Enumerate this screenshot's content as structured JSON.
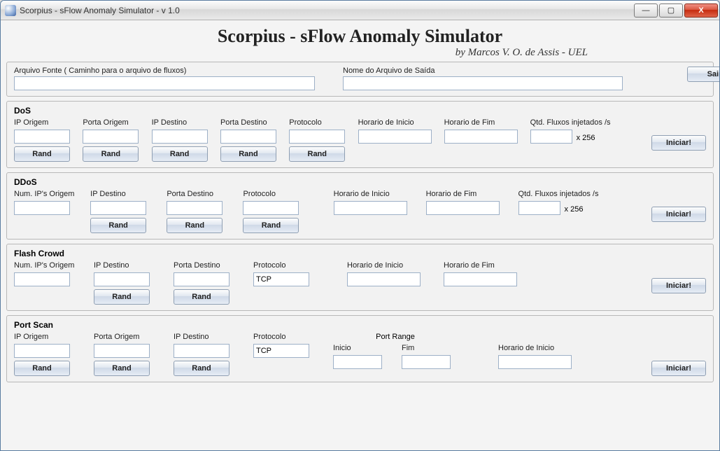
{
  "window": {
    "title": "Scorpius - sFlow Anomaly Simulator - v 1.0"
  },
  "header": {
    "title": "Scorpius - sFlow Anomaly Simulator",
    "subtitle": "by Marcos V. O. de Assis - UEL"
  },
  "files": {
    "source_label": "Arquivo Fonte ( Caminho para o arquivo de fluxos)",
    "source_value": "",
    "output_label": "Nome do Arquivo de Saída",
    "output_value": "",
    "exit_button": "Sair"
  },
  "common": {
    "rand": "Rand",
    "start": "Iniciar!",
    "x256": "x 256"
  },
  "dos": {
    "title": "DoS",
    "ip_origem": "IP Origem",
    "porta_origem": "Porta Origem",
    "ip_destino": "IP Destino",
    "porta_destino": "Porta Destino",
    "protocolo": "Protocolo",
    "horario_inicio": "Horario de Inicio",
    "horario_fim": "Horario de Fim",
    "qtd_fluxos": "Qtd. Fluxos injetados /s"
  },
  "ddos": {
    "title": "DDoS",
    "num_ips": "Num. IP's Origem",
    "ip_destino": "IP Destino",
    "porta_destino": "Porta Destino",
    "protocolo": "Protocolo",
    "horario_inicio": "Horario de Inicio",
    "horario_fim": "Horario de Fim",
    "qtd_fluxos": "Qtd. Fluxos injetados /s"
  },
  "flash": {
    "title": "Flash Crowd",
    "num_ips": "Num. IP's Origem",
    "ip_destino": "IP Destino",
    "porta_destino": "Porta Destino",
    "protocolo_label": "Protocolo",
    "protocolo_value": "TCP",
    "horario_inicio": "Horario de Inicio",
    "horario_fim": "Horario de Fim"
  },
  "portscan": {
    "title": "Port Scan",
    "ip_origem": "IP Origem",
    "porta_origem": "Porta Origem",
    "ip_destino": "IP Destino",
    "protocolo_label": "Protocolo",
    "protocolo_value": "TCP",
    "port_range": "Port Range",
    "inicio": "Inicio",
    "fim": "Fim",
    "horario_inicio": "Horario de Inicio"
  }
}
